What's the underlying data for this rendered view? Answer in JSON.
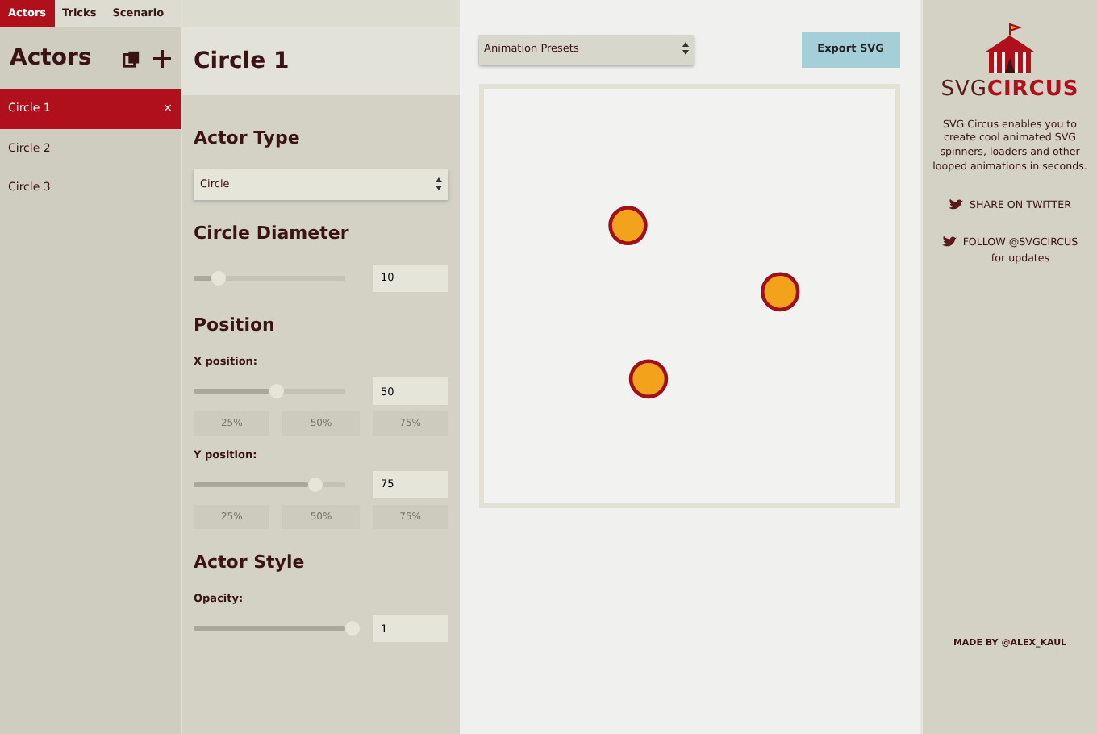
{
  "tabs": [
    {
      "label": "Actors",
      "selected": true
    },
    {
      "label": "Tricks",
      "selected": false
    },
    {
      "label": "Scenario",
      "selected": false
    }
  ],
  "actors": {
    "title": "Actors",
    "items": [
      {
        "label": "Circle 1",
        "selected": true,
        "close": "×"
      },
      {
        "label": "Circle 2",
        "selected": false
      },
      {
        "label": "Circle 3",
        "selected": false
      }
    ]
  },
  "properties": {
    "title": "Circle 1",
    "sections": [
      {
        "heading": "Actor Type",
        "controls": [
          {
            "kind": "select",
            "value": "Circle"
          }
        ]
      },
      {
        "heading": "Circle Diameter",
        "controls": [
          {
            "kind": "slider",
            "level": 0.12,
            "value": "10"
          }
        ]
      },
      {
        "heading": "Position",
        "controls": [
          {
            "kind": "label",
            "text": "X position:"
          },
          {
            "kind": "slider",
            "level": 0.5,
            "value": "50"
          },
          {
            "kind": "presets",
            "buttons": [
              "25%",
              "50%",
              "75%"
            ]
          },
          {
            "kind": "label",
            "text": "Y position:"
          },
          {
            "kind": "slider",
            "level": 0.75,
            "value": "75"
          },
          {
            "kind": "presets",
            "buttons": [
              "25%",
              "50%",
              "75%"
            ]
          }
        ]
      },
      {
        "heading": "Actor Style",
        "controls": [
          {
            "kind": "label",
            "text": "Opacity:"
          },
          {
            "kind": "slider",
            "level": 1,
            "value": "1"
          }
        ]
      }
    ]
  },
  "stage": {
    "presets": {
      "value": "Animation Presets"
    },
    "export_button": "Export SVG"
  },
  "sidebar": {
    "logo": {
      "part_1": "SVG",
      "part_2": "CIRCUS"
    },
    "description": "SVG Circus enables you to create cool animated SVG spinners, loaders and other looped animations in seconds.",
    "share": "SHARE ON TWITTER",
    "follow": "FOLLOW @SVGCIRCUS",
    "follow_note": "for updates",
    "credit": "MADE BY @ALEX_KAUL"
  }
}
